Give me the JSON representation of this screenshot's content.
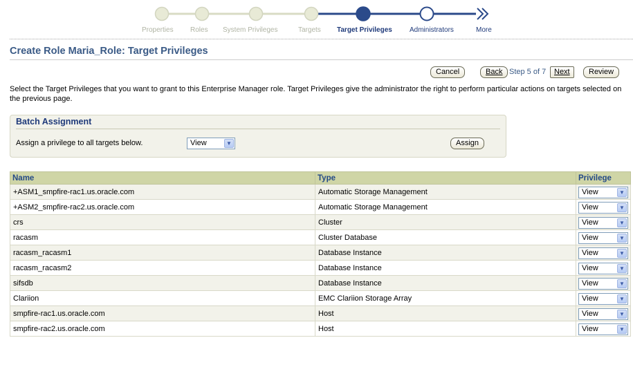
{
  "train": {
    "steps": [
      {
        "label": "Properties",
        "state": "visited"
      },
      {
        "label": "Roles",
        "state": "visited"
      },
      {
        "label": "System Privileges",
        "state": "visited"
      },
      {
        "label": "Targets",
        "state": "visited"
      },
      {
        "label": "Target Privileges",
        "state": "current"
      },
      {
        "label": "Administrators",
        "state": "next"
      },
      {
        "label": "More",
        "state": "more"
      }
    ],
    "colors": {
      "visited": "#e8ead6",
      "current": "#2b4a8a",
      "line": "#2b4a8a"
    }
  },
  "header": {
    "title": "Create Role Maria_Role: Target Privileges"
  },
  "nav": {
    "cancel_label": "Cancel",
    "back_prefix": "",
    "back_accel": "Back",
    "step_text": "Step 5 of 7",
    "next_accel": "Next",
    "review_label": "Review"
  },
  "instructions": "Select the Target Privileges that you want to grant to this Enterprise Manager role. Target Privileges give the administrator the right to perform particular actions on targets selected on the previous page.",
  "batch": {
    "title": "Batch Assignment",
    "label": "Assign a privilege to all targets below.",
    "selected": "View",
    "assign_label": "Assign"
  },
  "table": {
    "headers": {
      "name": "Name",
      "type": "Type",
      "privilege": "Privilege"
    },
    "rows": [
      {
        "name": "+ASM1_smpfire-rac1.us.oracle.com",
        "type": "Automatic Storage Management",
        "privilege": "View"
      },
      {
        "name": "+ASM2_smpfire-rac2.us.oracle.com",
        "type": "Automatic Storage Management",
        "privilege": "View"
      },
      {
        "name": "crs",
        "type": "Cluster",
        "privilege": "View"
      },
      {
        "name": "racasm",
        "type": "Cluster Database",
        "privilege": "View"
      },
      {
        "name": "racasm_racasm1",
        "type": "Database Instance",
        "privilege": "View"
      },
      {
        "name": "racasm_racasm2",
        "type": "Database Instance",
        "privilege": "View"
      },
      {
        "name": "sifsdb",
        "type": "Database Instance",
        "privilege": "View"
      },
      {
        "name": "Clariion",
        "type": "EMC Clariion Storage Array",
        "privilege": "View"
      },
      {
        "name": "smpfire-rac1.us.oracle.com",
        "type": "Host",
        "privilege": "View"
      },
      {
        "name": "smpfire-rac2.us.oracle.com",
        "type": "Host",
        "privilege": "View"
      }
    ]
  },
  "icons": {
    "dropdown": "chevron-down-icon",
    "more": "double-chevron-right-icon"
  }
}
